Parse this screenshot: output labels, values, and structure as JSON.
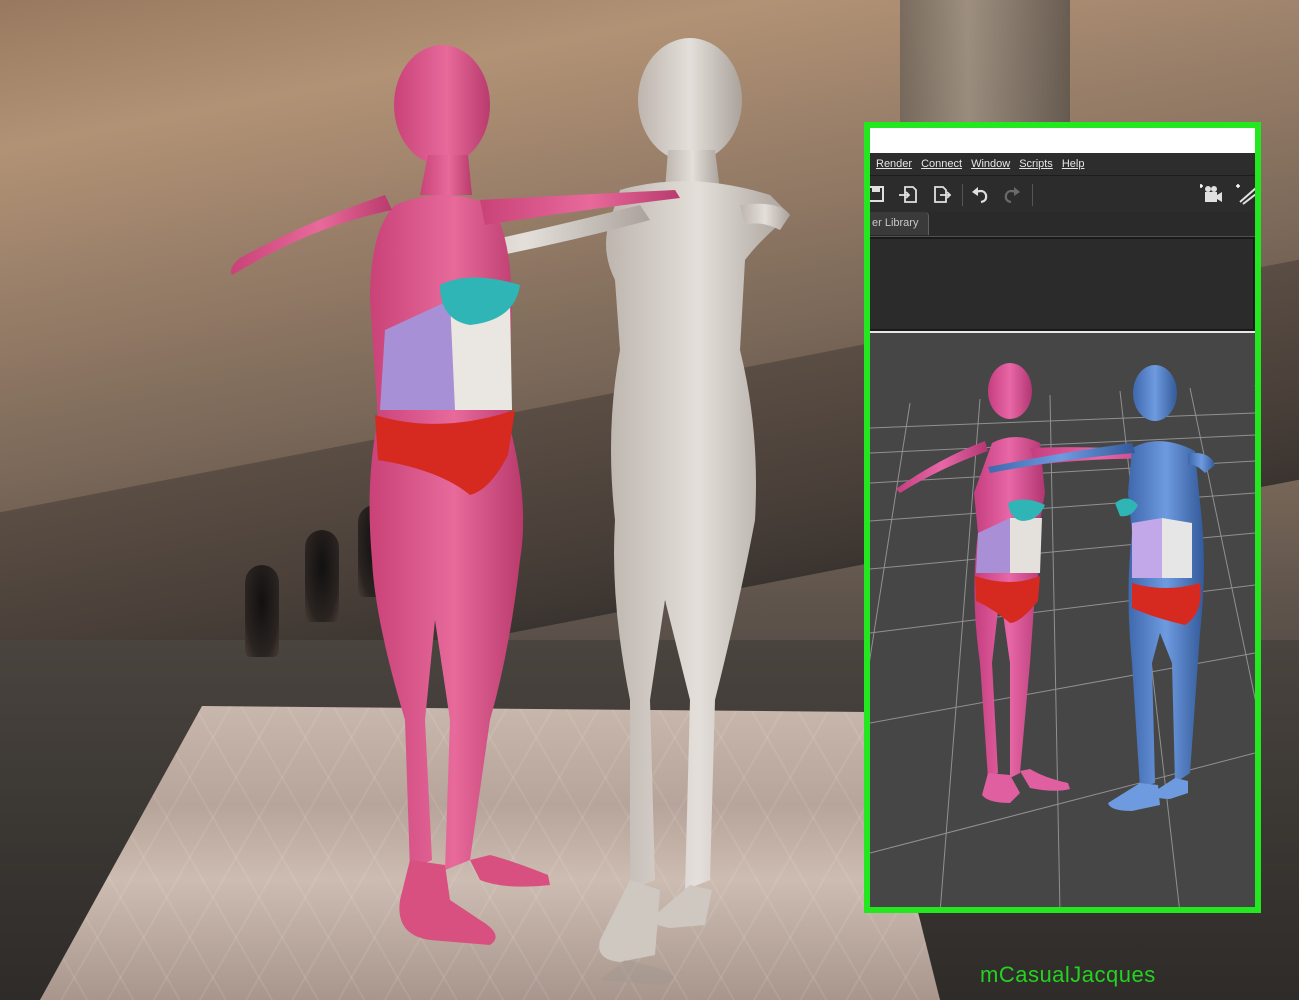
{
  "app": {
    "menu": [
      {
        "label": "Render"
      },
      {
        "label": "Connect"
      },
      {
        "label": "Window"
      },
      {
        "label": "Scripts"
      },
      {
        "label": "Help"
      }
    ],
    "toolbar": [
      {
        "icon": "save-icon"
      },
      {
        "icon": "import-icon"
      },
      {
        "icon": "export-icon"
      },
      {
        "icon": "undo-icon"
      },
      {
        "icon": "redo-icon"
      },
      {
        "icon": "camera-add-icon"
      },
      {
        "icon": "light-add-icon"
      }
    ],
    "active_tab": "er Library"
  },
  "colors": {
    "frame": "#23e81f",
    "figure_left": "#e05a8f",
    "figure_right_render": "#d9d3cd",
    "figure_right_viewport": "#5a86c8",
    "bra": "#2fb5b5",
    "briefs": "#d62a20",
    "panel": "#8f7ec4"
  },
  "watermark": "mCasualJacques"
}
